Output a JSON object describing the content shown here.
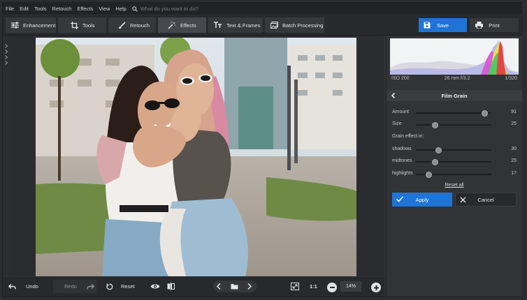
{
  "menu": [
    "File",
    "Edit",
    "Tools",
    "Retouch",
    "Effects",
    "View",
    "Help"
  ],
  "search": {
    "placeholder": "What do you want to do?"
  },
  "tabs": [
    {
      "label": "Enhancement",
      "icon": "sliders-icon"
    },
    {
      "label": "Tools",
      "icon": "crop-icon"
    },
    {
      "label": "Retouch",
      "icon": "brush-icon"
    },
    {
      "label": "Effects",
      "icon": "magic-wand-icon",
      "active": true
    },
    {
      "label": "Text & Frames",
      "icon": "text-icon"
    },
    {
      "label": "Batch Processing",
      "icon": "batch-icon"
    }
  ],
  "actions": {
    "save": "Save",
    "print": "Print"
  },
  "exif": {
    "iso": "ISO 200",
    "lens": "26 mm f/3.2",
    "shutter": "1/320"
  },
  "panel": {
    "title": "Film Grain",
    "sliders": [
      {
        "label": "Amount",
        "value": "91",
        "pct": 0.91
      },
      {
        "label": "Size",
        "value": "25",
        "pct": 0.25
      }
    ],
    "section": "Grain effect in:",
    "grain_sliders": [
      {
        "label": "shadows",
        "value": "30",
        "pct": 0.3
      },
      {
        "label": "midtones",
        "value": "25",
        "pct": 0.25
      },
      {
        "label": "highlights",
        "value": "17",
        "pct": 0.17
      }
    ],
    "reset_all": "Reset all",
    "apply": "Apply",
    "cancel": "Cancel"
  },
  "bottom": {
    "undo": "Undo",
    "redo": "Redo",
    "reset": "Reset",
    "ratio": "1:1",
    "zoom": "14%"
  },
  "colors": {
    "accent": "#1f74d6",
    "background": "#2f3134"
  }
}
